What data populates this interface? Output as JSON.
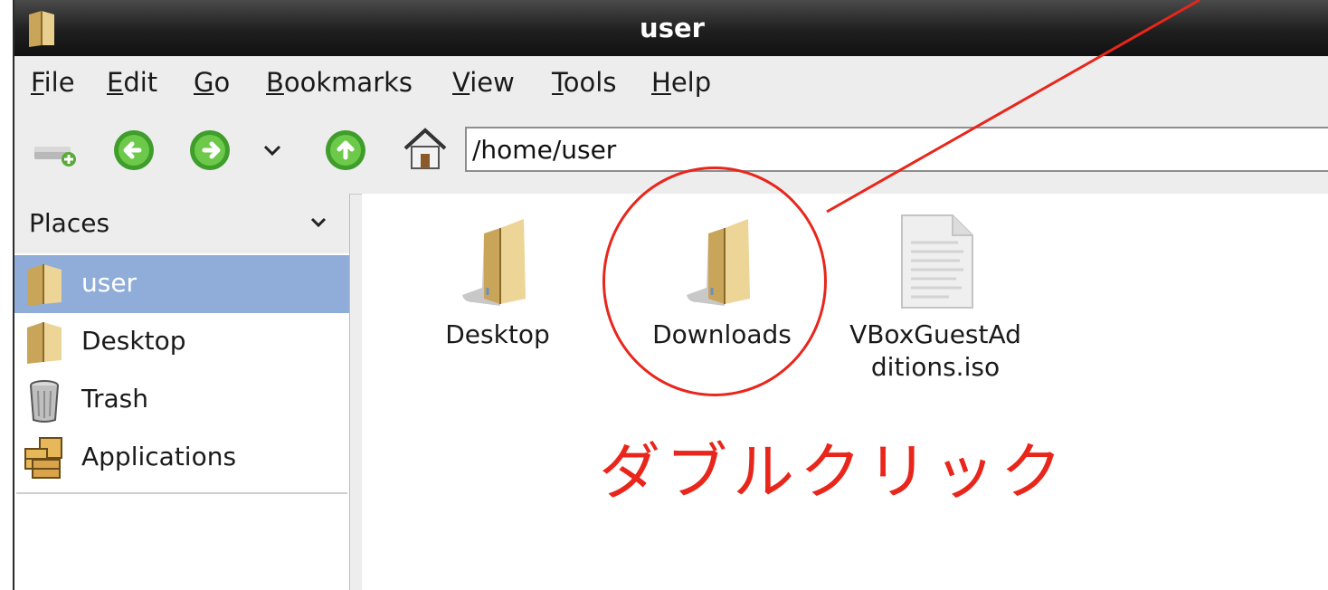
{
  "window": {
    "title": "user"
  },
  "menubar": {
    "items": [
      {
        "mnemonic": "F",
        "rest": "ile"
      },
      {
        "mnemonic": "E",
        "rest": "dit"
      },
      {
        "mnemonic": "G",
        "rest": "o"
      },
      {
        "mnemonic": "B",
        "rest": "ookmarks"
      },
      {
        "mnemonic": "V",
        "rest": "iew"
      },
      {
        "mnemonic": "T",
        "rest": "ools"
      },
      {
        "mnemonic": "H",
        "rest": "elp"
      }
    ]
  },
  "toolbar": {
    "location_value": "/home/user"
  },
  "sidebar": {
    "header": "Places",
    "items": [
      {
        "label": "user",
        "icon": "folder-icon",
        "selected": true
      },
      {
        "label": "Desktop",
        "icon": "folder-icon"
      },
      {
        "label": "Trash",
        "icon": "trash-icon"
      },
      {
        "label": "Applications",
        "icon": "applications-icon"
      }
    ]
  },
  "files": [
    {
      "name": "Desktop",
      "icon": "folder-icon"
    },
    {
      "name": "Downloads",
      "icon": "folder-icon"
    },
    {
      "name_line1": "VBoxGuestAd",
      "name_line2": "ditions.iso",
      "icon": "document-icon"
    }
  ],
  "annotation": {
    "text": "ダブルクリック",
    "color": "#e8261b"
  },
  "colors": {
    "selection": "#8fadd8",
    "titlebar": "#1f1f1f"
  }
}
